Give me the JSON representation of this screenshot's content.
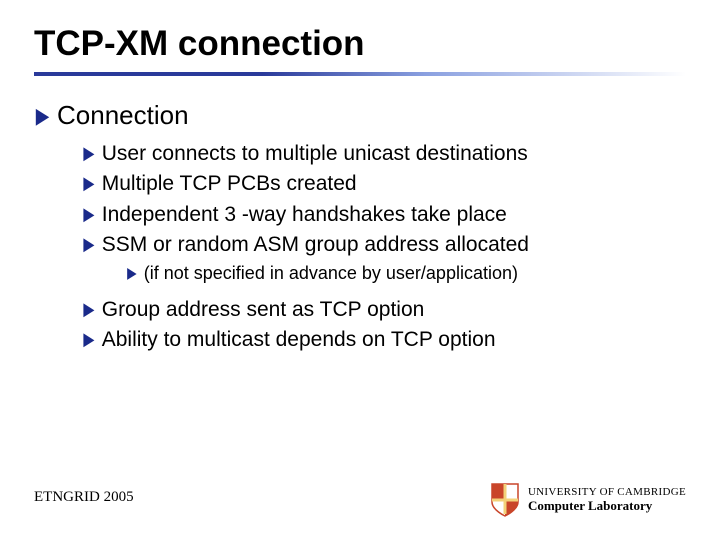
{
  "title": "TCP-XM connection",
  "content": {
    "lvl1": "Connection",
    "lvl2_a": [
      "User connects to multiple unicast destinations",
      "Multiple TCP PCBs created",
      "Independent 3 -way handshakes take place",
      "SSM or random ASM group address allocated"
    ],
    "lvl3": "(if not specified in advance by user/application)",
    "lvl2_b": [
      "Group address sent as TCP option",
      "Ability to multicast depends on TCP option"
    ]
  },
  "footer": {
    "left": "ETNGRID 2005",
    "logo": {
      "uni_line": "UNIVERSITY OF CAMBRIDGE",
      "lab_line": "Computer Laboratory"
    }
  },
  "bullet_glyph": "▶"
}
